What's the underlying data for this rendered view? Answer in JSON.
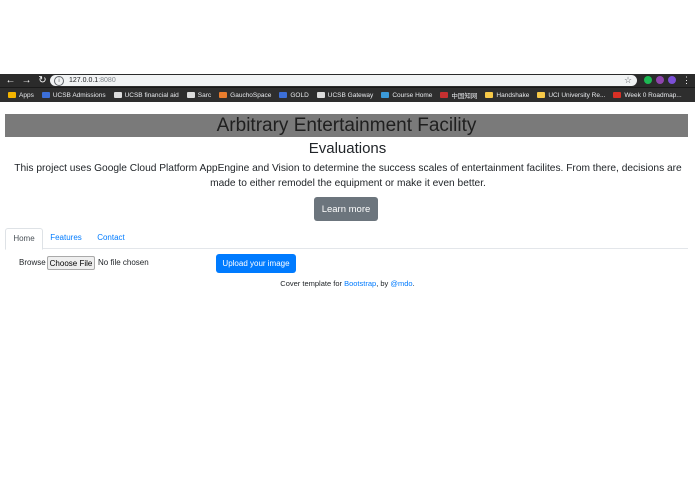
{
  "browser": {
    "url_host": "127.0.0.1",
    "url_port": ":8080",
    "bookmarks": [
      {
        "label": "Apps",
        "color": "#f4b400"
      },
      {
        "label": "UCSB Admissions",
        "color": "#3c6fd8"
      },
      {
        "label": "UCSB financial aid",
        "color": "#dddddd"
      },
      {
        "label": "Sarc",
        "color": "#dddddd"
      },
      {
        "label": "GauchoSpace",
        "color": "#e97d2d"
      },
      {
        "label": "GOLD",
        "color": "#3c6fd8"
      },
      {
        "label": "UCSB Gateway",
        "color": "#dddddd"
      },
      {
        "label": "Course Home",
        "color": "#3b9ad9"
      },
      {
        "label": "中国知网",
        "color": "#c53030"
      },
      {
        "label": "Handshake",
        "color": "#f7c948"
      },
      {
        "label": "UCI University Re...",
        "color": "#f7c948"
      },
      {
        "label": "Week 0 Roadmap...",
        "color": "#d93025"
      }
    ]
  },
  "hero": {
    "title": "Arbitrary Entertainment Facility"
  },
  "lead": {
    "title": "Evaluations",
    "text": "This project uses Google Cloud Platform AppEngine and Vision to determine the success scales of entertainment facilites. From there, decisions are made to either remodel the equipment or make it even better.",
    "button": "Learn more"
  },
  "tabs": [
    "Home",
    "Features",
    "Contact"
  ],
  "upload": {
    "browse_label": "Browse",
    "choose_label": "Choose File",
    "no_file": "No file chosen",
    "submit": "Upload your image"
  },
  "footer": {
    "prefix": "Cover template for ",
    "link1": "Bootstrap",
    "middle": ", by ",
    "link2": "@mdo",
    "suffix": "."
  }
}
